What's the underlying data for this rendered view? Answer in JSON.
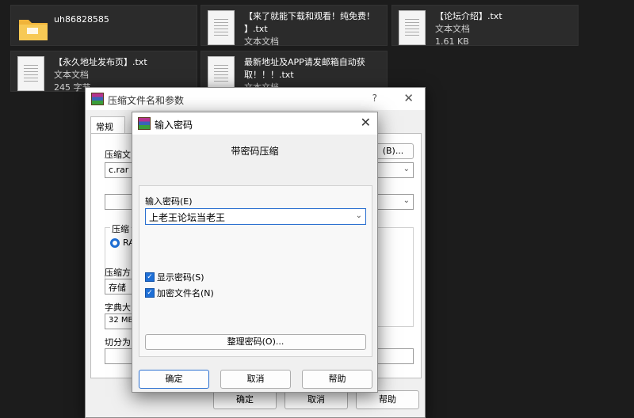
{
  "files": [
    {
      "name": "uh86828585",
      "line2": "",
      "line3": "",
      "icon": "folder-icon"
    },
    {
      "name": "【来了就能下载和观看！纯免费！",
      "line2": "】.txt",
      "line3": "文本文档",
      "icon": "text-document-icon"
    },
    {
      "name": "【论坛介绍】.txt",
      "line2": "文本文档",
      "line3": "1.61 KB",
      "icon": "text-document-icon"
    },
    {
      "name": "【永久地址发布页】.txt",
      "line2": "文本文档",
      "line3": "245 字节",
      "icon": "text-document-icon"
    },
    {
      "name": "最新地址及APP请发邮箱自动获",
      "line2": "取！！！.txt",
      "line3": "文本文档",
      "icon": "text-document-icon"
    }
  ],
  "back_dialog": {
    "title": "压缩文件名和参数",
    "help_glyph": "?",
    "close_glyph": "✕",
    "tab_general": "常规",
    "archive_name_label": "压缩文",
    "archive_name_value": "c.rar",
    "browse_label": "(B)...",
    "format_label": "压缩",
    "format_option": "RA",
    "method_label": "压缩方",
    "method_value": "存储",
    "dict_label": "字典大",
    "dict_value": "32 MB",
    "split_label": "切分为",
    "ok_label": "确定",
    "cancel_label": "取消",
    "help_label": "帮助"
  },
  "password_dialog": {
    "title": "输入密码",
    "close_glyph": "✕",
    "heading": "带密码压缩",
    "password_label": "输入密码(E)",
    "password_value": "上老王论坛当老王",
    "show_password_label": "显示密码(S)",
    "encrypt_names_label": "加密文件名(N)",
    "organize_label": "整理密码(O)...",
    "ok_label": "确定",
    "cancel_label": "取消",
    "help_label": "帮助"
  },
  "colors": {
    "accent": "#1e6fd6",
    "desktop_bg": "#1c1c1c",
    "tile_bg": "#2b2b2b"
  }
}
